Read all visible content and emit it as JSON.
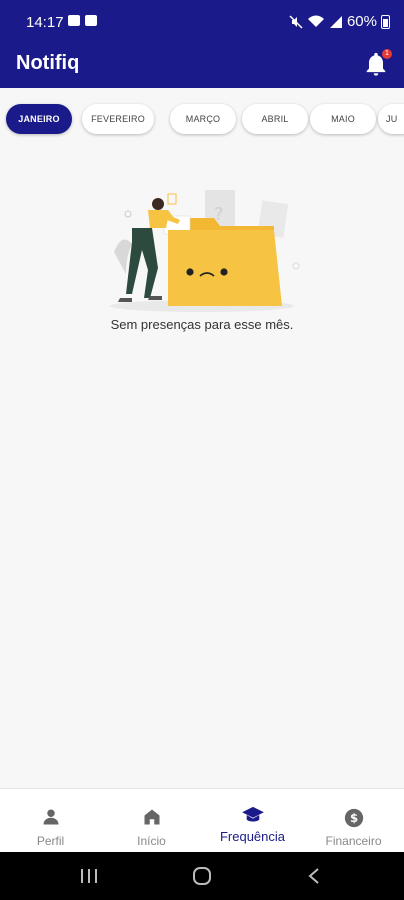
{
  "status": {
    "time": "14:17",
    "battery": "60%"
  },
  "appbar": {
    "title": "Notifiq",
    "notification_count": "1"
  },
  "months": [
    {
      "label": "JANEIRO",
      "active": true
    },
    {
      "label": "FEVEREIRO",
      "active": false
    },
    {
      "label": "MARÇO",
      "active": false
    },
    {
      "label": "ABRIL",
      "active": false
    },
    {
      "label": "MAIO",
      "active": false
    },
    {
      "label": "JU",
      "active": false
    }
  ],
  "empty_state": {
    "message": "Sem presenças para esse mês."
  },
  "bottom_nav": [
    {
      "label": "Perfil",
      "icon": "person-icon",
      "active": false
    },
    {
      "label": "Início",
      "icon": "home-icon",
      "active": false
    },
    {
      "label": "Frequência",
      "icon": "graduation-cap-icon",
      "active": true
    },
    {
      "label": "Financeiro",
      "icon": "dollar-icon",
      "active": false
    }
  ],
  "colors": {
    "primary": "#1a1a8a",
    "folder": "#f6c343",
    "badge": "#e53935"
  }
}
